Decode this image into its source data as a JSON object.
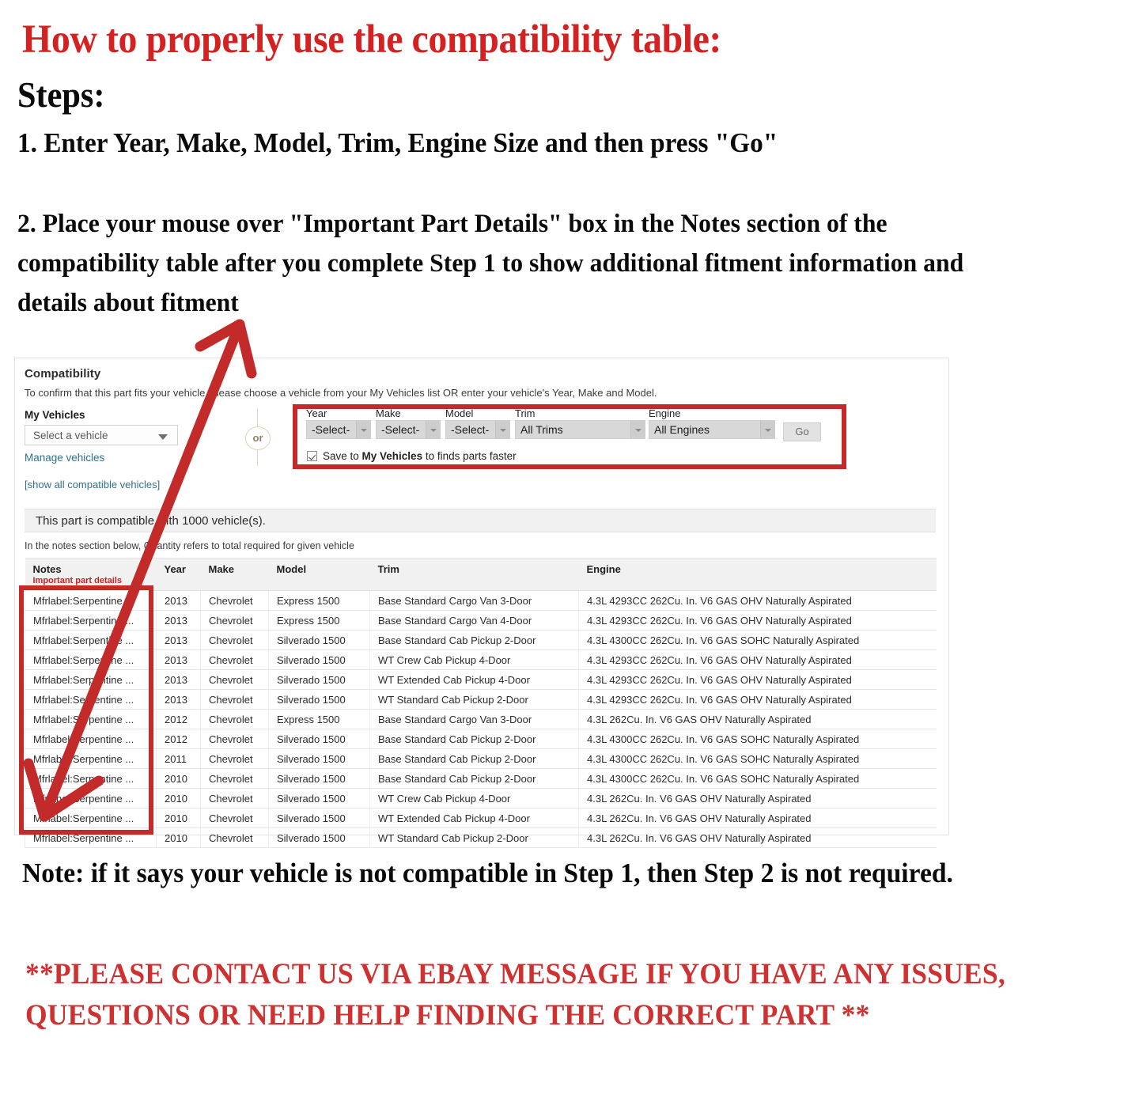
{
  "headline": "How to properly use the compatibility table:",
  "steps_label": "Steps:",
  "step1": "1. Enter Year, Make, Model, Trim, Engine Size and then press \"Go\"",
  "step2": "2. Place your mouse over \"Important Part Details\" box in the Notes section of the compatibility table after you complete Step 1 to show additional fitment information and details about fitment",
  "note": "Note: if it says your vehicle is not compatible in Step 1, then Step 2 is not required.",
  "contact": "**PLEASE CONTACT US VIA EBAY MESSAGE IF YOU HAVE ANY ISSUES, QUESTIONS OR NEED HELP FINDING THE CORRECT PART **",
  "colors": {
    "headline_red": "#d42222",
    "annotation_red": "#c32b2b",
    "contact_red": "#cf3030",
    "link_blue": "#31708d",
    "notes_red": "#cc2222"
  },
  "panel": {
    "title": "Compatibility",
    "subtitle": "To confirm that this part fits your vehicle, please choose a vehicle from your My Vehicles list OR enter your vehicle's Year, Make and Model.",
    "my_vehicles": {
      "label": "My Vehicles",
      "select_value": "Select a vehicle",
      "manage_link": "Manage vehicles"
    },
    "or_divider": "or",
    "show_all_link": "[show all compatible vehicles]",
    "compatible_banner": "This part is compatible with 1000 vehicle(s).",
    "quantity_note": "In the notes section below, Quantity refers to total required for given vehicle",
    "form": {
      "fields": [
        {
          "label": "Year",
          "value": "-Select-"
        },
        {
          "label": "Make",
          "value": "-Select-"
        },
        {
          "label": "Model",
          "value": "-Select-"
        },
        {
          "label": "Trim",
          "value": "All Trims"
        },
        {
          "label": "Engine",
          "value": "All Engines"
        }
      ],
      "go_label": "Go",
      "save_prefix": "Save to ",
      "save_bold": "My Vehicles",
      "save_suffix": " to finds parts faster"
    },
    "table": {
      "headers": [
        "Notes",
        "Year",
        "Make",
        "Model",
        "Trim",
        "Engine"
      ],
      "notes_subheader": "Important part details",
      "rows": [
        [
          "Mfrlabel:Serpentine ...",
          "2013",
          "Chevrolet",
          "Express 1500",
          "Base Standard Cargo Van 3-Door",
          "4.3L 4293CC 262Cu. In. V6 GAS OHV Naturally Aspirated"
        ],
        [
          "Mfrlabel:Serpentine ...",
          "2013",
          "Chevrolet",
          "Express 1500",
          "Base Standard Cargo Van 4-Door",
          "4.3L 4293CC 262Cu. In. V6 GAS OHV Naturally Aspirated"
        ],
        [
          "Mfrlabel:Serpentine ...",
          "2013",
          "Chevrolet",
          "Silverado 1500",
          "Base Standard Cab Pickup 2-Door",
          "4.3L 4300CC 262Cu. In. V6 GAS SOHC Naturally Aspirated"
        ],
        [
          "Mfrlabel:Serpentine ...",
          "2013",
          "Chevrolet",
          "Silverado 1500",
          "WT Crew Cab Pickup 4-Door",
          "4.3L 4293CC 262Cu. In. V6 GAS OHV Naturally Aspirated"
        ],
        [
          "Mfrlabel:Serpentine ...",
          "2013",
          "Chevrolet",
          "Silverado 1500",
          "WT Extended Cab Pickup 4-Door",
          "4.3L 4293CC 262Cu. In. V6 GAS OHV Naturally Aspirated"
        ],
        [
          "Mfrlabel:Serpentine ...",
          "2013",
          "Chevrolet",
          "Silverado 1500",
          "WT Standard Cab Pickup 2-Door",
          "4.3L 4293CC 262Cu. In. V6 GAS OHV Naturally Aspirated"
        ],
        [
          "Mfrlabel:Serpentine ...",
          "2012",
          "Chevrolet",
          "Express 1500",
          "Base Standard Cargo Van 3-Door",
          "4.3L 262Cu. In. V6 GAS OHV Naturally Aspirated"
        ],
        [
          "Mfrlabel:Serpentine ...",
          "2012",
          "Chevrolet",
          "Silverado 1500",
          "Base Standard Cab Pickup 2-Door",
          "4.3L 4300CC 262Cu. In. V6 GAS SOHC Naturally Aspirated"
        ],
        [
          "Mfrlabel:Serpentine ...",
          "2011",
          "Chevrolet",
          "Silverado 1500",
          "Base Standard Cab Pickup 2-Door",
          "4.3L 4300CC 262Cu. In. V6 GAS SOHC Naturally Aspirated"
        ],
        [
          "Mfrlabel:Serpentine ...",
          "2010",
          "Chevrolet",
          "Silverado 1500",
          "Base Standard Cab Pickup 2-Door",
          "4.3L 4300CC 262Cu. In. V6 GAS SOHC Naturally Aspirated"
        ],
        [
          "Mfrlabel:Serpentine ...",
          "2010",
          "Chevrolet",
          "Silverado 1500",
          "WT Crew Cab Pickup 4-Door",
          "4.3L 262Cu. In. V6 GAS OHV Naturally Aspirated"
        ],
        [
          "Mfrlabel:Serpentine ...",
          "2010",
          "Chevrolet",
          "Silverado 1500",
          "WT Extended Cab Pickup 4-Door",
          "4.3L 262Cu. In. V6 GAS OHV Naturally Aspirated"
        ],
        [
          "Mfrlabel:Serpentine ...",
          "2010",
          "Chevrolet",
          "Silverado 1500",
          "WT Standard Cab Pickup 2-Door",
          "4.3L 262Cu. In. V6 GAS OHV Naturally Aspirated"
        ]
      ]
    }
  }
}
